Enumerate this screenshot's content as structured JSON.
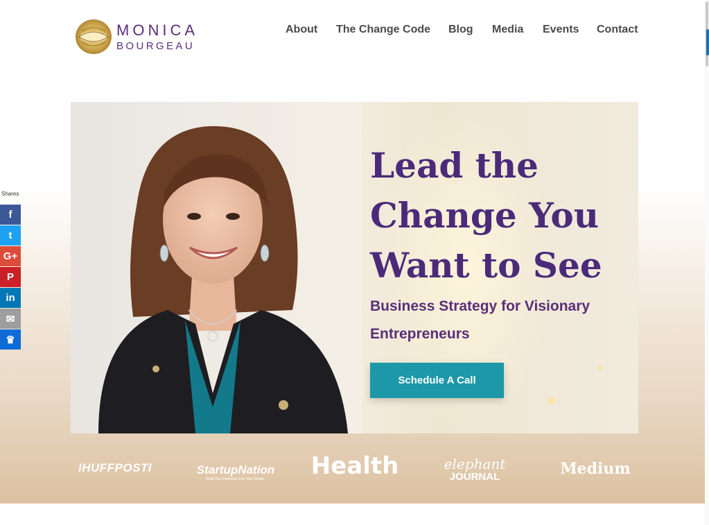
{
  "brand": {
    "name_line1": "MONICA",
    "name_line2": "BOURGEAU",
    "colors": {
      "purple": "#4b2a7a",
      "teal": "#1c98a8",
      "gold": "#c9a24a"
    }
  },
  "nav": {
    "items": [
      {
        "label": "About"
      },
      {
        "label": "The Change Code"
      },
      {
        "label": "Blog"
      },
      {
        "label": "Media"
      },
      {
        "label": "Events"
      },
      {
        "label": "Contact"
      }
    ]
  },
  "hero": {
    "headline_lines": [
      "Lead the",
      "Change  You",
      "Want to See"
    ],
    "subheadline": "Business Strategy for Visionary Entrepreneurs",
    "cta_label": "Schedule A Call"
  },
  "press_logos": [
    {
      "name": "HUFFPOST",
      "text": "IHUFFPOSTI"
    },
    {
      "name": "StartupNation",
      "text": "StartupNation",
      "tagline": "Build Your Business. Live Your Dream."
    },
    {
      "name": "Health",
      "text": "Health"
    },
    {
      "name": "elephant journal",
      "text_top": "elephant",
      "text_bottom": "JOURNAL"
    },
    {
      "name": "Medium",
      "text": "Medium"
    }
  ],
  "share": {
    "label": "Shares",
    "buttons": [
      {
        "name": "facebook",
        "icon": "facebook-icon",
        "glyph": "f",
        "color": "#3b5998"
      },
      {
        "name": "twitter",
        "icon": "twitter-icon",
        "glyph": "t",
        "color": "#1da1f2"
      },
      {
        "name": "google-plus",
        "icon": "google-plus-icon",
        "glyph": "G+",
        "color": "#dd4b39"
      },
      {
        "name": "pinterest",
        "icon": "pinterest-icon",
        "glyph": "P",
        "color": "#cb2027"
      },
      {
        "name": "linkedin",
        "icon": "linkedin-icon",
        "glyph": "in",
        "color": "#0077b5"
      },
      {
        "name": "email",
        "icon": "email-icon",
        "glyph": "✉",
        "color": "#9e9e9e"
      },
      {
        "name": "sumome",
        "icon": "sumome-icon",
        "glyph": "♛",
        "color": "#0f6bd6"
      }
    ]
  }
}
